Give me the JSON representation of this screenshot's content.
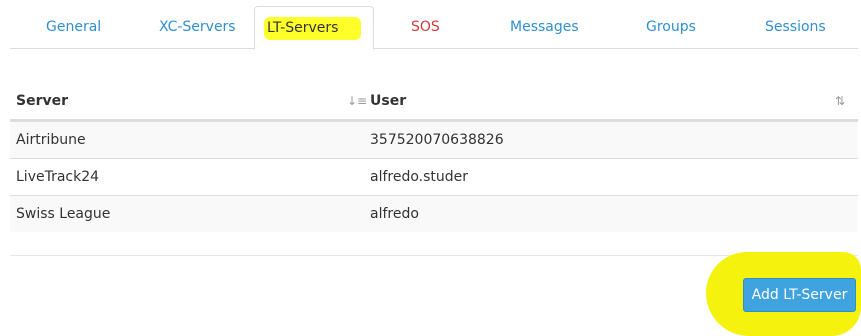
{
  "tabs": [
    {
      "label": "General"
    },
    {
      "label": "XC-Servers"
    },
    {
      "label": "LT-Servers"
    },
    {
      "label": "SOS"
    },
    {
      "label": "Messages"
    },
    {
      "label": "Groups"
    },
    {
      "label": "Sessions"
    }
  ],
  "active_tab": "LT-Servers",
  "colors": {
    "tab_link": "#2f8fd1",
    "sos": "#d13b3b",
    "highlight": "#ffff2a",
    "button": "#3fa3e0"
  },
  "table": {
    "columns": [
      "Server",
      "User"
    ],
    "rows": [
      {
        "server": "Airtribune",
        "user": "357520070638826"
      },
      {
        "server": "LiveTrack24",
        "user": "alfredo.studer"
      },
      {
        "server": "Swiss League",
        "user": "alfredo"
      }
    ],
    "sort_icons": [
      "sort-amount-icon",
      "sort-icon"
    ]
  },
  "actions": {
    "add_label": "Add LT-Server"
  }
}
